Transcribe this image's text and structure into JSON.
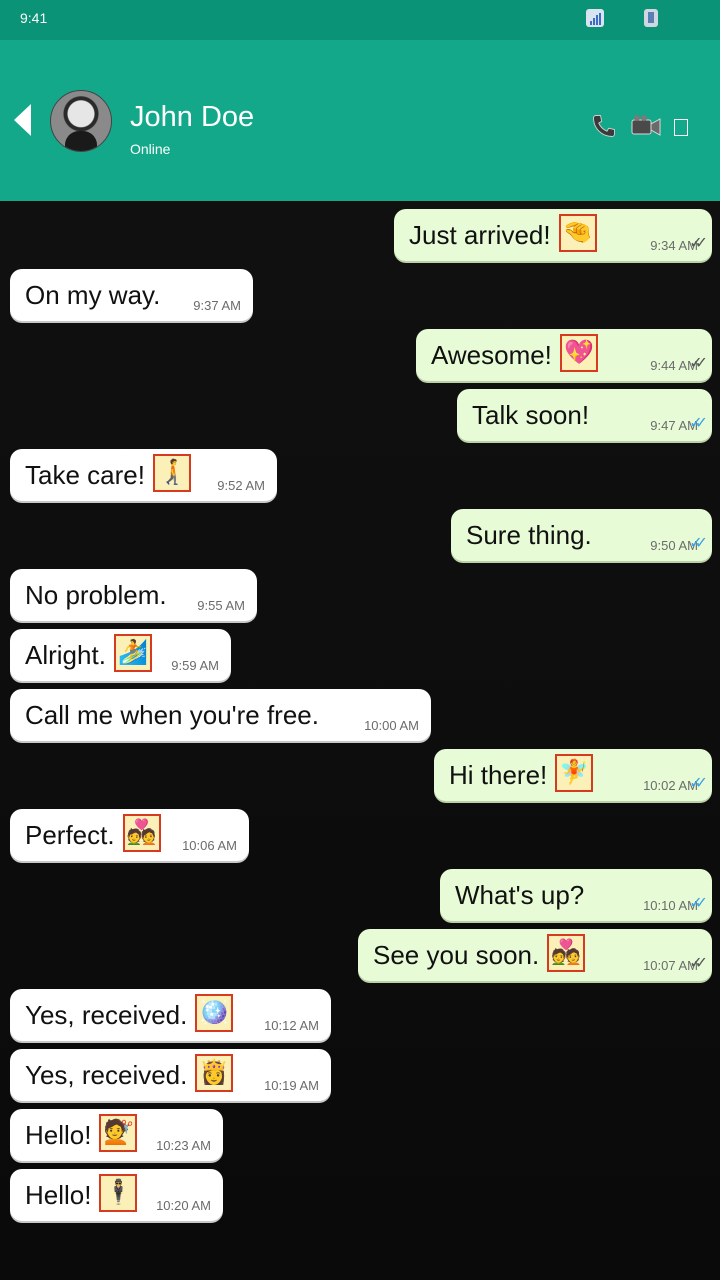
{
  "status_bar": {
    "time": "9:41"
  },
  "header": {
    "contact_name": "John Doe",
    "contact_status": "Online"
  },
  "messages": [
    {
      "dir": "out",
      "text": "Just arrived!",
      "emoji": "🤏",
      "time": "9:34 AM",
      "ticks": "sent"
    },
    {
      "dir": "in",
      "text": "On my way.",
      "emoji": "",
      "time": "9:37 AM"
    },
    {
      "dir": "out",
      "text": "Awesome!",
      "emoji": "💖",
      "time": "9:44 AM",
      "ticks": "sent"
    },
    {
      "dir": "out",
      "text": "Talk soon!",
      "emoji": "",
      "time": "9:47 AM",
      "ticks": "read"
    },
    {
      "dir": "in",
      "text": "Take care!",
      "emoji": "🚶‍➡️",
      "time": "9:52 AM"
    },
    {
      "dir": "out",
      "text": "Sure thing.",
      "emoji": "",
      "time": "9:50 AM",
      "ticks": "read"
    },
    {
      "dir": "in",
      "text": "No problem.",
      "emoji": "",
      "time": "9:55 AM"
    },
    {
      "dir": "in",
      "text": "Alright.",
      "emoji": "🏄",
      "time": "9:59 AM"
    },
    {
      "dir": "in",
      "text": "Call me when you're free.",
      "emoji": "",
      "time": "10:00 AM"
    },
    {
      "dir": "out",
      "text": "Hi there!",
      "emoji": "🧚",
      "time": "10:02 AM",
      "ticks": "read"
    },
    {
      "dir": "in",
      "text": "Perfect.",
      "emoji": "💑",
      "time": "10:06 AM"
    },
    {
      "dir": "out",
      "text": "What's up?",
      "emoji": "",
      "time": "10:10 AM",
      "ticks": "read"
    },
    {
      "dir": "out",
      "text": "See you soon.",
      "emoji": "💑",
      "time": "10:07 AM",
      "ticks": "sent"
    },
    {
      "dir": "in",
      "text": "Yes, received.",
      "emoji": "🪩",
      "time": "10:12 AM"
    },
    {
      "dir": "in",
      "text": "Yes, received.",
      "emoji": "👸",
      "time": "10:19 AM"
    },
    {
      "dir": "in",
      "text": "Hello!",
      "emoji": "💇",
      "time": "10:23 AM"
    },
    {
      "dir": "in",
      "text": "Hello!",
      "emoji": "🕴️",
      "time": "10:20 AM"
    }
  ]
}
